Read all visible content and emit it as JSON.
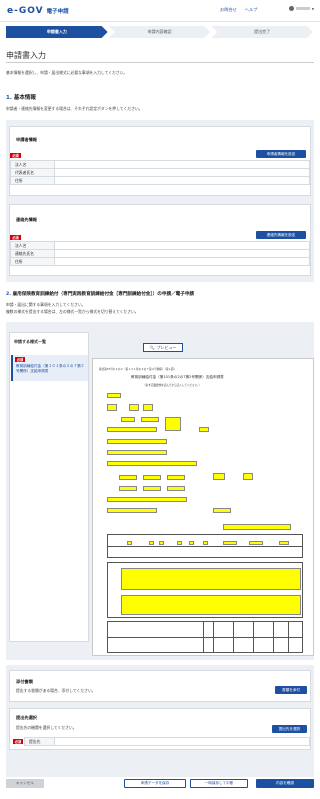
{
  "header": {
    "logo_mark": "e-GOV",
    "logo_text": "電子申請",
    "links": [
      "お問合せ",
      "ヘルプ"
    ],
    "user_name": "▼"
  },
  "steps": [
    "申請書入力",
    "申請内容確認",
    "提出完了"
  ],
  "page_title": "申請書入力",
  "intro": "基本情報を選択し、申請・届出様式に必要な事項を入力してください。",
  "section1": {
    "number": "1.",
    "title": "基本情報",
    "note": "申請者・連絡先情報を変更する場合は、それぞれ設定ボタンを押してください。",
    "applicant": {
      "title": "申請者情報",
      "button": "申請者情報を設定",
      "required": "必須",
      "rows": [
        "法人名",
        "代表者氏名",
        "住所"
      ]
    },
    "contact": {
      "title": "連絡先情報",
      "button": "連絡先情報を設定",
      "required": "必須",
      "rows": [
        "法人名",
        "連絡先氏名",
        "住所"
      ]
    }
  },
  "section2": {
    "number": "2.",
    "title": "雇用保険教育訓練給付（専門実践教育訓練給付金［専門訓練給付金］）の申請／電子申請",
    "note1": "申請・届出に関する事項を入力してください。",
    "note2": "複数の様式を提出する場合は、左の様式一覧から様式を切り替えてください。",
    "form_list_title": "申請する様式一覧",
    "form_required": "必須",
    "form_item": "教育訓練給付金（第１０１条の２の７第２号関係）支給申請書",
    "preview_label": "プレビュー",
    "doc_header": "様式第33号の２の２（第１０１条の２の７第２号関係）（第１面）",
    "doc_title": "教育訓練給付金（第101条の2の7第2号関係）支給申請書",
    "doc_sub": "（必ず記載要領を読んでから記入してください。）"
  },
  "attachments": {
    "title": "添付書類",
    "note": "提出する書類がある場合、添付してください。",
    "button": "書類を添付"
  },
  "destination": {
    "title": "提出先選択",
    "note": "提出先の機関を選択してください。",
    "button": "提出先を選択",
    "required": "必須",
    "row_label": "提出先"
  },
  "footer": {
    "cancel": "キャンセル",
    "save": "申請データを保存",
    "interrupt": "一時保存して中断",
    "confirm": "内容を確認"
  }
}
